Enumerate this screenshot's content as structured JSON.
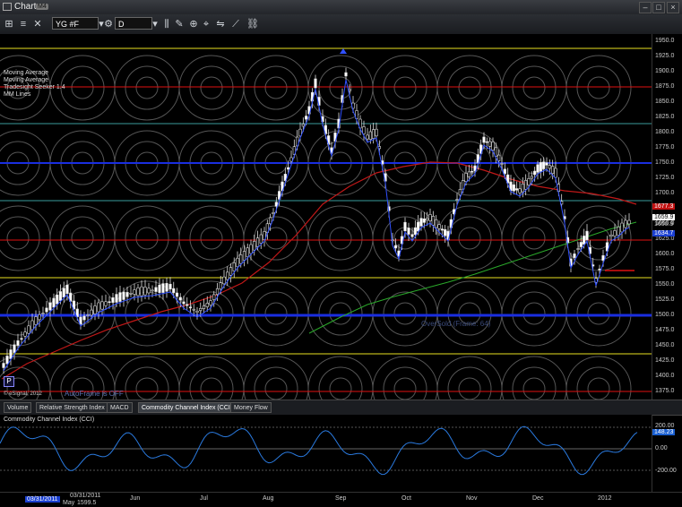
{
  "window": {
    "title": "Chart",
    "badge": "M4"
  },
  "toolbar": {
    "symbol": "YG #F",
    "interval": "D"
  },
  "studies_legend": [
    "Moving Average",
    "Moving Average",
    "Tradesight Seeker 1.4",
    "MM Lines"
  ],
  "chart_notes": {
    "esignal": "© eSignal, 2012",
    "autoframe": "AutoFrame is OFF",
    "oversold": "OverSold (Frame: 64)",
    "p_button": "P",
    "u_button": "U"
  },
  "tabs": [
    "Volume",
    "Relative Strength Index",
    "MACD",
    "Commodity Channel Index (CCI)",
    "Money Flow"
  ],
  "cci_panel": {
    "label": "Commodity Channel Index (CCI)",
    "ticks": [
      "200.00",
      "0.00",
      "-200.00"
    ],
    "current": "148.23"
  },
  "price_axis": {
    "ticks": [
      "1950.0",
      "1925.0",
      "1900.0",
      "1875.0",
      "1850.0",
      "1825.0",
      "1800.0",
      "1775.0",
      "1750.0",
      "1725.0",
      "1700.0",
      "1675.0",
      "1650.0",
      "1625.0",
      "1600.0",
      "1575.0",
      "1550.0",
      "1525.0",
      "1500.0",
      "1475.0",
      "1450.0",
      "1425.0",
      "1400.0",
      "1375.0"
    ],
    "marker_red": "1677.3",
    "marker_white": "1659.9",
    "marker_blue": "1634.7",
    "extra": "1650.9"
  },
  "x_axis": {
    "cursor_date": "03/31/2011",
    "cursor_date2": "03/31/2011",
    "month_small": "May",
    "price_small": "1599.5",
    "months": [
      "Jun",
      "Jul",
      "Aug",
      "Sep",
      "Oct",
      "Nov",
      "Dec",
      "2012"
    ]
  },
  "colors": {
    "yellow": "#e8e020",
    "red": "#e01010",
    "blue": "#1020e0",
    "teal": "#3a9c9c",
    "green": "#2aa82a",
    "candle_blue": "#3050ff"
  }
}
